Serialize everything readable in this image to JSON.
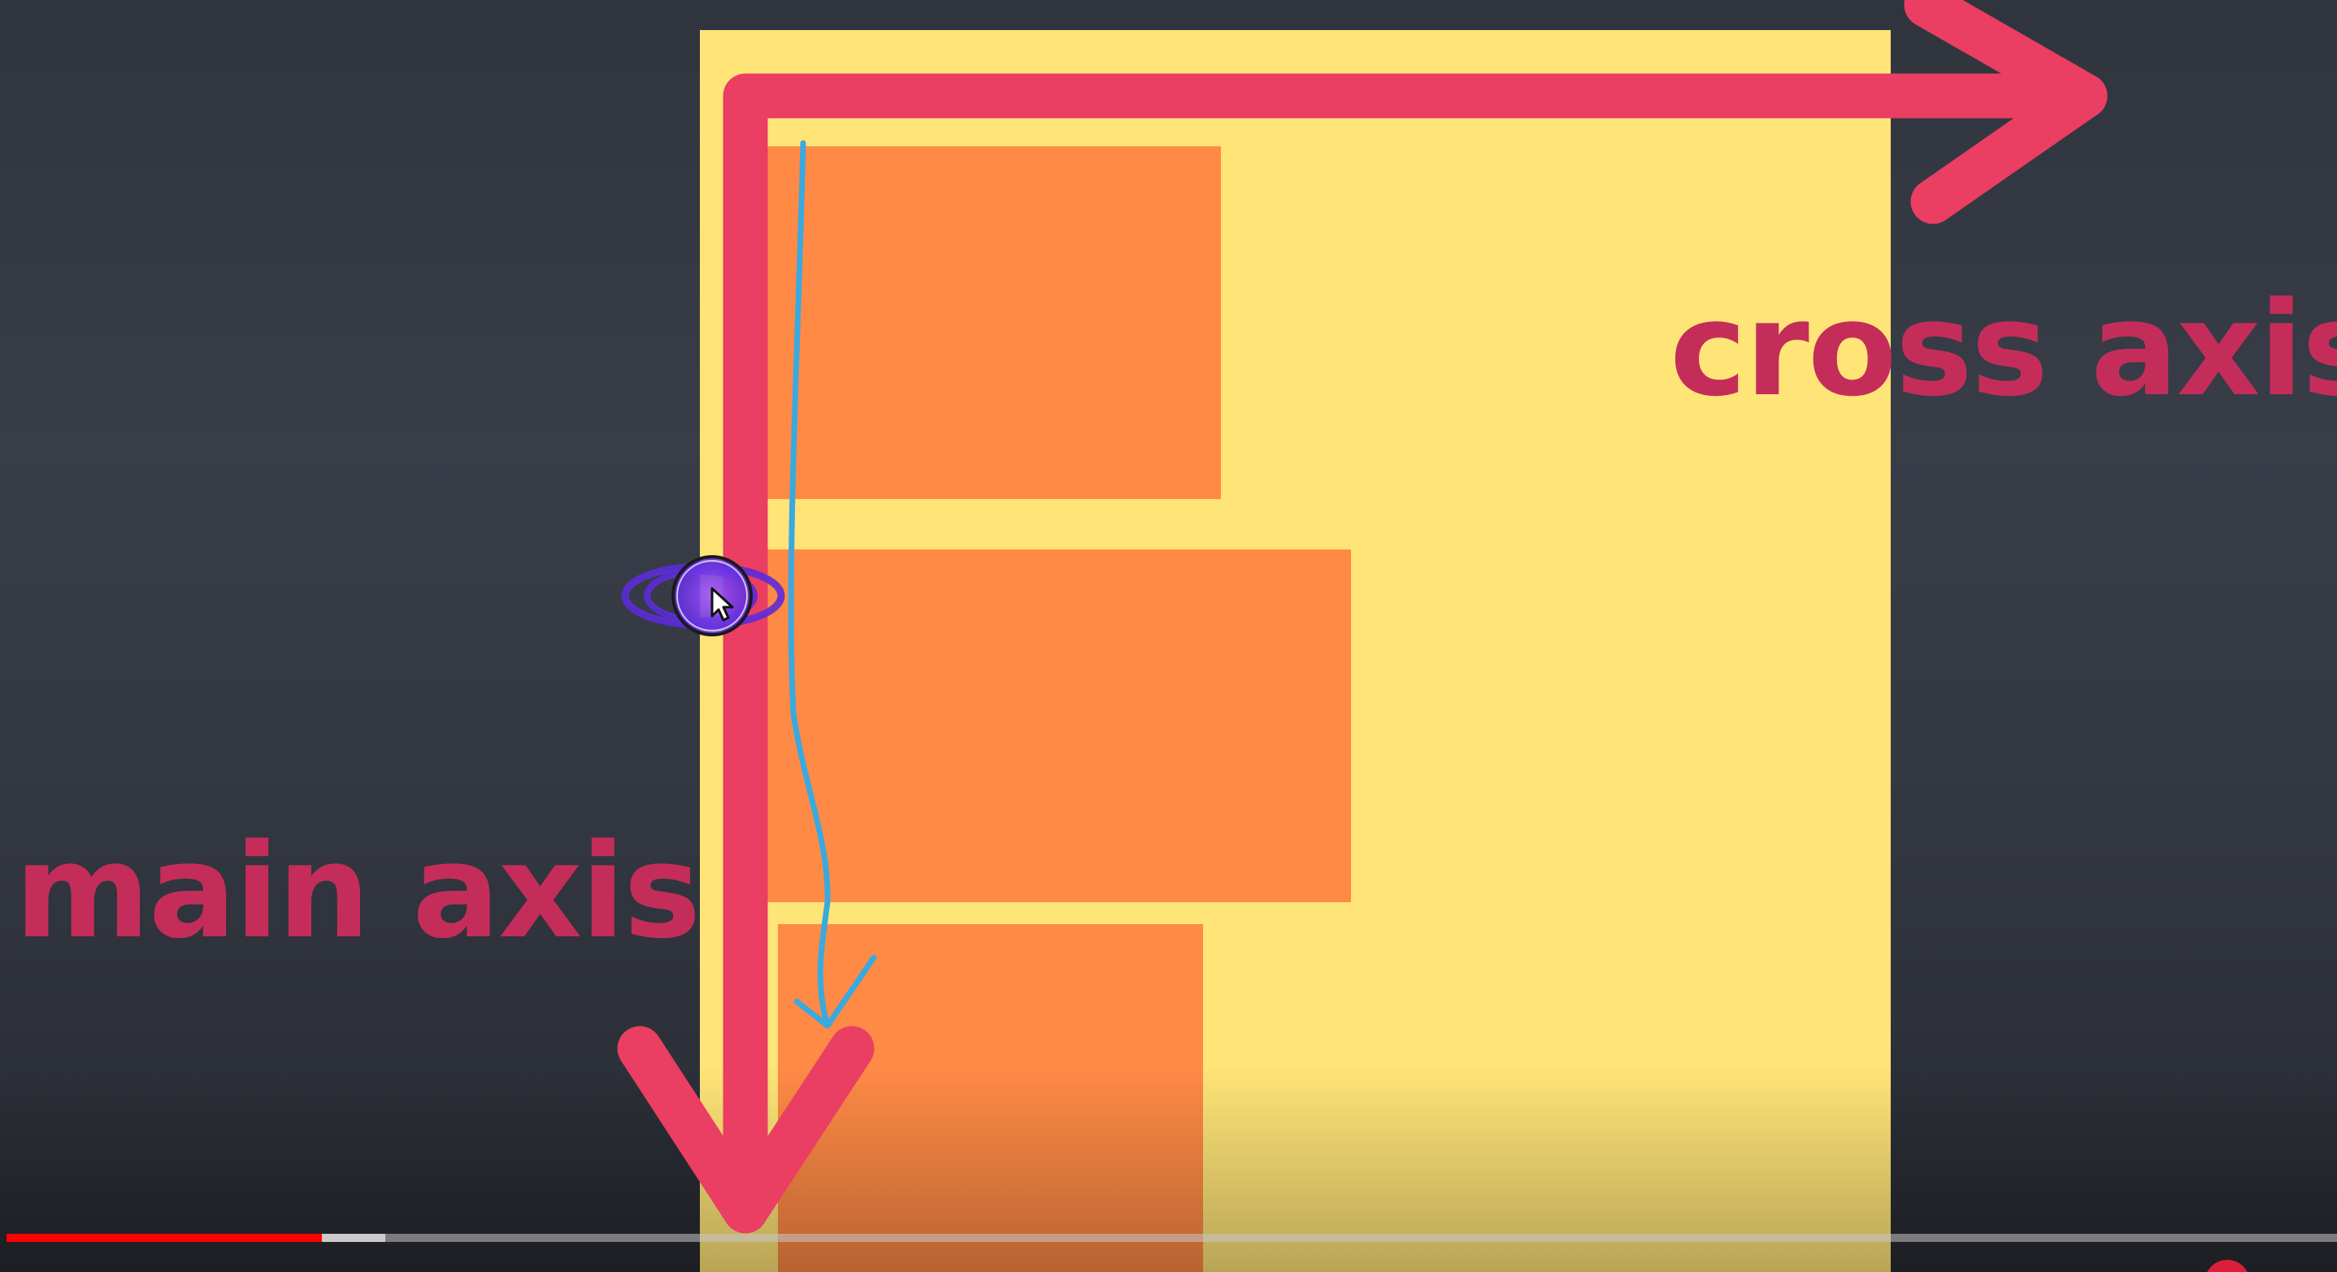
{
  "diagram": {
    "cross_axis_label": "cross axis",
    "main_axis_label": "main axis",
    "colors": {
      "background": "#343842",
      "container": "#ffe477",
      "flex_item": "#ff8a45",
      "axis_arrow": "#ea3e62",
      "axis_label": "#c42d5a",
      "annotation_stroke": "#3aa9e0",
      "cursor_highlight": "#7b3cf0"
    },
    "icons": {
      "cursor": "mouse-pointer-icon"
    }
  },
  "player": {
    "progress_played_fraction": 0.1355,
    "progress_buffered_fraction": 0.1624
  }
}
